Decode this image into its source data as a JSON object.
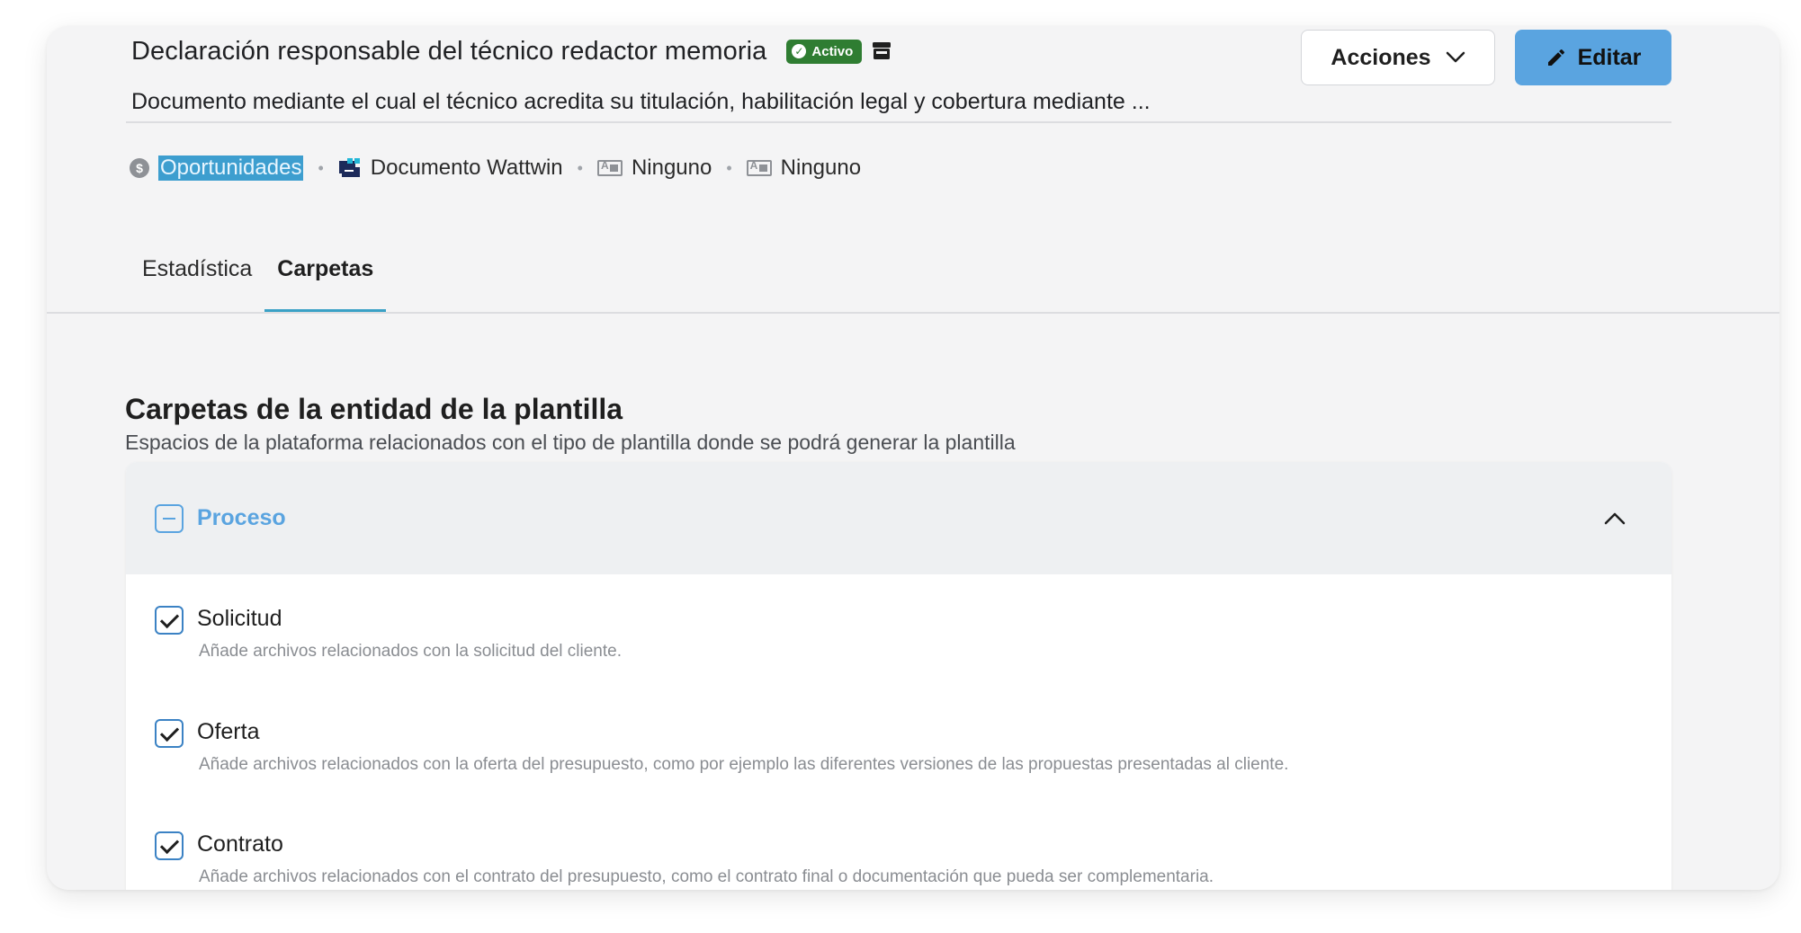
{
  "header": {
    "title": "Declaración responsable del técnico redactor memoria",
    "status_badge": "Activo",
    "description": "Documento mediante el cual el técnico acredita su titulación, habilitación legal y cobertura mediante ...",
    "actions_label": "Acciones",
    "edit_label": "Editar"
  },
  "meta": {
    "entity": "Oportunidades",
    "doc_type": "Documento Wattwin",
    "field_1": "Ninguno",
    "field_2": "Ninguno"
  },
  "tabs": [
    {
      "label": "Estadística"
    },
    {
      "label": "Carpetas"
    }
  ],
  "section": {
    "title": "Carpetas de la entidad de la plantilla",
    "subtitle": "Espacios de la plataforma relacionados con el tipo de plantilla donde se podrá generar la plantilla"
  },
  "group": {
    "name": "Proceso",
    "items": [
      {
        "label": "Solicitud",
        "desc": "Añade archivos relacionados con la solicitud del cliente."
      },
      {
        "label": "Oferta",
        "desc": "Añade archivos relacionados con la oferta del presupuesto, como por ejemplo las diferentes versiones de las propuestas presentadas al cliente."
      },
      {
        "label": "Contrato",
        "desc": "Añade archivos relacionados con el contrato del presupuesto, como el contrato final o documentación que pueda ser complementaria."
      }
    ]
  },
  "colors": {
    "accent": "#5aa4e0",
    "active_badge": "#2f7d32",
    "tab_underline": "#3aa1c6"
  }
}
